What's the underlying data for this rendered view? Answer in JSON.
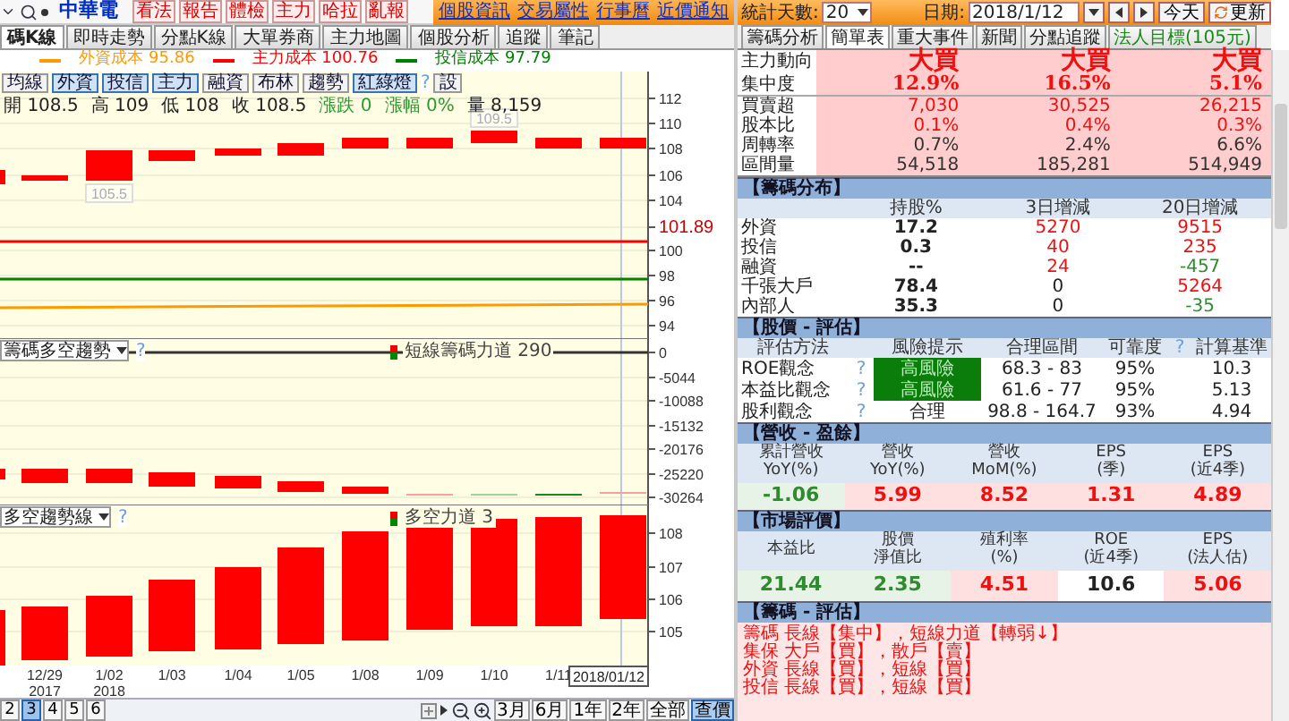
{
  "toolbar": {
    "stock_name": "中華電",
    "buttons": [
      "看法",
      "報告",
      "體檢",
      "主力",
      "哈拉",
      "亂報"
    ],
    "links": [
      "個股資訊",
      "交易屬性",
      "行事曆",
      "近價通知"
    ]
  },
  "chart_tabs": [
    {
      "label": "碼K線",
      "selected": true
    },
    {
      "label": "即時走勢",
      "selected": false
    },
    {
      "label": "分點K線",
      "selected": false
    },
    {
      "label": "大單券商",
      "selected": false
    },
    {
      "label": "主力地圖",
      "selected": false
    },
    {
      "label": "個股分析",
      "selected": false
    },
    {
      "label": "追蹤",
      "selected": false
    },
    {
      "label": "筆記",
      "selected": false
    }
  ],
  "cost_legend": [
    {
      "label": "外資成本 95.86",
      "color": "#ff9900"
    },
    {
      "label": "主力成本 100.76",
      "color": "#ff0000"
    },
    {
      "label": "投信成本 97.79",
      "color": "#008000"
    }
  ],
  "indicator_buttons": [
    {
      "label": "均線",
      "selected": false
    },
    {
      "label": "外資",
      "selected": true
    },
    {
      "label": "投信",
      "selected": true
    },
    {
      "label": "主力",
      "selected": true
    },
    {
      "label": "融資",
      "selected": false
    },
    {
      "label": "布林",
      "selected": false
    },
    {
      "label": "趨勢",
      "selected": false
    },
    {
      "label": "紅綠燈",
      "selected": true
    }
  ],
  "help_mark": "?",
  "settings_button": "設",
  "ohlc": [
    {
      "label": "開",
      "value": "108.5",
      "kind": "plain"
    },
    {
      "label": "高",
      "value": "109",
      "kind": "plain"
    },
    {
      "label": "低",
      "value": "108",
      "kind": "plain"
    },
    {
      "label": "收",
      "value": "108.5",
      "kind": "plain"
    },
    {
      "label": "漲跌",
      "value": "0",
      "kind": "change"
    },
    {
      "label": "漲幅",
      "value": "0%",
      "kind": "change"
    },
    {
      "label": "量",
      "value": "8,159",
      "kind": "plain"
    }
  ],
  "price_panel": {
    "axis": [
      "112",
      "110",
      "108",
      "106",
      "104",
      "101.89",
      "100",
      "98",
      "96",
      "94"
    ],
    "tags": [
      "105.5",
      "109.5"
    ]
  },
  "chip_panel": {
    "selector": "籌碼多空趨勢",
    "help": "?",
    "legend": "短線籌碼力道 290",
    "axis": [
      "0",
      "-5044",
      "-10088",
      "-15132",
      "-20176",
      "-25220",
      "-30264"
    ]
  },
  "trend_panel": {
    "selector": "多空趨勢線",
    "help": "?",
    "legend": "多空力道 3",
    "axis": [
      "108",
      "107",
      "106",
      "105"
    ]
  },
  "x_axis": [
    {
      "date": "12/29",
      "year": "2017"
    },
    {
      "date": "1/02",
      "year": "2018"
    },
    {
      "date": "1/03"
    },
    {
      "date": "1/04"
    },
    {
      "date": "1/05"
    },
    {
      "date": "1/08"
    },
    {
      "date": "1/09"
    },
    {
      "date": "1/10"
    },
    {
      "date": "1/11"
    }
  ],
  "cursor_date": "2018/01/12",
  "pager": [
    {
      "label": "2",
      "selected": false
    },
    {
      "label": "3",
      "selected": true
    },
    {
      "label": "4",
      "selected": false
    },
    {
      "label": "5",
      "selected": false
    },
    {
      "label": "6",
      "selected": false
    }
  ],
  "range_buttons": [
    {
      "label": "3月",
      "selected": false
    },
    {
      "label": "6月",
      "selected": false
    },
    {
      "label": "1年",
      "selected": false
    },
    {
      "label": "2年",
      "selected": false
    },
    {
      "label": "全部",
      "selected": false
    },
    {
      "label": "查價",
      "selected": true
    }
  ],
  "stats_bar": {
    "days_label": "統計天數:",
    "days": "20",
    "date_label": "日期:",
    "date": "2018/1/12",
    "today_button": "今天",
    "refresh_button": "更新"
  },
  "info_tabs": [
    {
      "label": "籌碼分析",
      "selected": false,
      "kind": "normal"
    },
    {
      "label": "簡單表",
      "selected": true,
      "kind": "normal"
    },
    {
      "label": "重大事件",
      "selected": false,
      "kind": "normal"
    },
    {
      "label": "新聞",
      "selected": false,
      "kind": "normal"
    },
    {
      "label": "分點追蹤",
      "selected": false,
      "kind": "normal"
    },
    {
      "label": "法人目標(105元)",
      "selected": false,
      "kind": "target"
    }
  ],
  "main_force": [
    {
      "label": "主力動向",
      "kind": "signal",
      "values": [
        "大買",
        "大買",
        "大買"
      ]
    },
    {
      "label": "集中度",
      "kind": "ratio",
      "values": [
        "12.9%",
        "16.5%",
        "5.1%"
      ]
    },
    {
      "label": "買賣超",
      "kind": "emph",
      "values": [
        "7,030",
        "30,525",
        "26,215"
      ]
    },
    {
      "label": "股本比",
      "kind": "emph",
      "values": [
        "0.1%",
        "0.4%",
        "0.3%"
      ]
    },
    {
      "label": "周轉率",
      "kind": "plain",
      "values": [
        "0.7%",
        "2.4%",
        "6.6%"
      ]
    },
    {
      "label": "區間量",
      "kind": "plain",
      "values": [
        "54,518",
        "185,281",
        "514,949"
      ]
    }
  ],
  "chip_distribution": {
    "title": "【籌碼分布】",
    "columns": [
      "持股%",
      "3日增減",
      "20日增減"
    ],
    "rows": [
      {
        "label": "外資",
        "cells": [
          {
            "text": "17.2",
            "kind": "flat"
          },
          {
            "text": "5270",
            "kind": "up"
          },
          {
            "text": "9515",
            "kind": "up"
          }
        ]
      },
      {
        "label": "投信",
        "cells": [
          {
            "text": "0.3",
            "kind": "flat"
          },
          {
            "text": "40",
            "kind": "up"
          },
          {
            "text": "235",
            "kind": "up"
          }
        ]
      },
      {
        "label": "融資",
        "cells": [
          {
            "text": "--",
            "kind": "flat"
          },
          {
            "text": "24",
            "kind": "up"
          },
          {
            "text": "-457",
            "kind": "down"
          }
        ]
      },
      {
        "label": "千張大戶",
        "cells": [
          {
            "text": "78.4",
            "kind": "flat"
          },
          {
            "text": "0",
            "kind": "flat"
          },
          {
            "text": "5264",
            "kind": "up"
          }
        ]
      },
      {
        "label": "內部人",
        "cells": [
          {
            "text": "35.3",
            "kind": "flat"
          },
          {
            "text": "0",
            "kind": "flat"
          },
          {
            "text": "-35",
            "kind": "down"
          }
        ]
      }
    ]
  },
  "valuation": {
    "title": "【股價 - 評估】",
    "columns": [
      "評估方法",
      "風險提示",
      "合理區間",
      "可靠度",
      "?",
      "計算基準"
    ],
    "rows": [
      {
        "method": "ROE觀念",
        "help": "?",
        "risk": "高風險",
        "kind": "high",
        "range": "68.3 - 83",
        "reliability": "95%",
        "basis": "10.3"
      },
      {
        "method": "本益比觀念",
        "help": "?",
        "risk": "高風險",
        "kind": "high",
        "range": "61.6 - 77",
        "reliability": "95%",
        "basis": "5.13"
      },
      {
        "method": "股利觀念",
        "help": "?",
        "risk": "合理",
        "kind": "ok",
        "range": "98.8 - 164.7",
        "reliability": "93%",
        "basis": "4.94"
      }
    ]
  },
  "revenue": {
    "title": "【營收 - 盈餘】",
    "columns": [
      {
        "line1": "累計營收",
        "line2": "YoY(%)"
      },
      {
        "line1": "營收",
        "line2": "YoY(%)"
      },
      {
        "line1": "營收",
        "line2": "MoM(%)"
      },
      {
        "line1": "EPS",
        "line2": "(季)"
      },
      {
        "line1": "EPS",
        "line2": "(近4季)"
      }
    ],
    "values": [
      {
        "text": "-1.06",
        "kind": "down"
      },
      {
        "text": "5.99",
        "kind": "up"
      },
      {
        "text": "8.52",
        "kind": "up"
      },
      {
        "text": "1.31",
        "kind": "up"
      },
      {
        "text": "4.89",
        "kind": "up"
      }
    ]
  },
  "market": {
    "title": "【市場評價】",
    "columns": [
      {
        "line1": "本益比"
      },
      {
        "line1": "股價",
        "line2": "淨值比"
      },
      {
        "line1": "殖利率",
        "line2": "(%)"
      },
      {
        "line1": "ROE",
        "line2": "(近4季)"
      },
      {
        "line1": "EPS",
        "line2": "(法人估)"
      }
    ],
    "values": [
      {
        "text": "21.44",
        "kind": "down"
      },
      {
        "text": "2.35",
        "kind": "down"
      },
      {
        "text": "4.51",
        "kind": "up"
      },
      {
        "text": "10.6",
        "kind": "flat"
      },
      {
        "text": "5.06",
        "kind": "up"
      }
    ]
  },
  "chip_eval": {
    "title": "【籌碼 - 評估】",
    "lines": [
      "籌碼 長線【集中】，短線力道【轉弱↓】",
      "集保 大戶【買】，散戶【賣】",
      "外資 長線【買】，短線【買】",
      "投信 長線【買】，短線【買】"
    ]
  }
}
